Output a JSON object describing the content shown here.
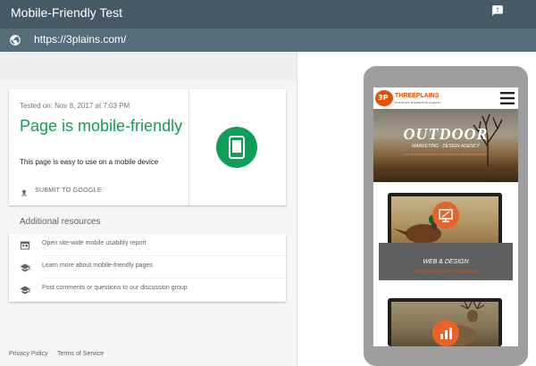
{
  "app": {
    "title": "Mobile-Friendly Test",
    "feedback_icon": "feedback-icon"
  },
  "url_bar": {
    "icon": "globe-icon",
    "value": "https://3plains.com/"
  },
  "result": {
    "tested_on": "Tested on: Nov 8, 2017 at 7:03 PM",
    "verdict": "Page is mobile-friendly",
    "description": "This page is easy to use on a mobile device",
    "submit_label": "SUBMIT TO GOOGLE",
    "submit_icon": "upload-icon",
    "badge_icon": "smartphone-icon",
    "verdict_color": "#0f9d58"
  },
  "resources": {
    "heading": "Additional resources",
    "items": [
      {
        "label": "Open site-wide mobile usability report",
        "icon": "report-icon"
      },
      {
        "label": "Learn more about mobile-friendly pages",
        "icon": "school-icon"
      },
      {
        "label": "Post comments or questions to our discussion group",
        "icon": "school-icon"
      }
    ]
  },
  "footer": {
    "privacy": "Privacy Policy",
    "terms": "Terms of Service"
  },
  "preview": {
    "logo_mark": "3P",
    "brand": "THREEPLAINS",
    "brand_tagline": "OUTDOOR MARKETING AGENCY",
    "menu_icon": "hamburger-menu-icon",
    "hero_title": "OUTDOOR",
    "hero_subtitle": "MARKETING · DESIGN AGENCY",
    "hero_tagline": "THE #1 OUTDOOR INDUSTRY MARKETING AND DESIGN AGENCY",
    "service1_title": "WEB & DESIGN",
    "service1_subtitle": "RESPONSIVE WEBSITES & BRANDING",
    "service1_icon": "monitor-edit-icon",
    "service2_icon": "bar-chart-icon"
  },
  "colors": {
    "header": "#455a64",
    "url_bar": "#546e7a",
    "accent_green": "#0f9d58",
    "brand_orange": "#e65100"
  }
}
